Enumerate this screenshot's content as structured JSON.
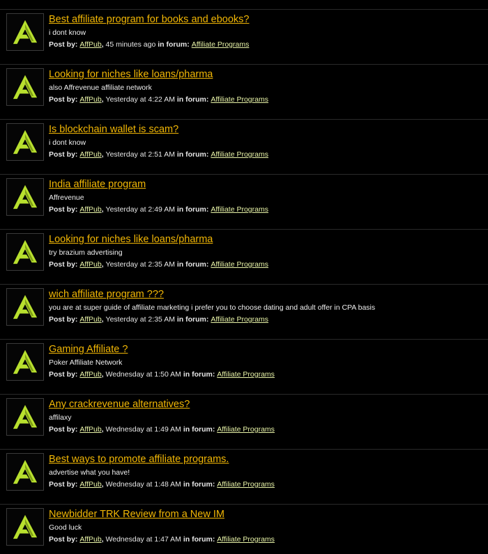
{
  "colors": {
    "background": "#000000",
    "title": "#f2b705",
    "link": "#e9f4a8",
    "logo_accent": "#b8e02e"
  },
  "avatar_icon": "affpub-logo-icon",
  "labels": {
    "post_by": "Post by:",
    "in_forum": "in forum:"
  },
  "posts": [
    {
      "title": "Best affiliate program for books and ebooks?",
      "snippet": "i dont know",
      "author": "AffPub",
      "time": "45 minutes ago",
      "forum": "Affiliate Programs"
    },
    {
      "title": "Looking for niches like loans/pharma",
      "snippet": "also Affrevenue affiliate network",
      "author": "AffPub",
      "time": "Yesterday at 4:22 AM",
      "forum": "Affiliate Programs"
    },
    {
      "title": "Is blockchain wallet is scam?",
      "snippet": "i dont know",
      "author": "AffPub",
      "time": "Yesterday at 2:51 AM",
      "forum": "Affiliate Programs"
    },
    {
      "title": "India affiliate program",
      "snippet": "Affrevenue",
      "author": "AffPub",
      "time": "Yesterday at 2:49 AM",
      "forum": "Affiliate Programs"
    },
    {
      "title": "Looking for niches like loans/pharma",
      "snippet": "try brazium advertising",
      "author": "AffPub",
      "time": "Yesterday at 2:35 AM",
      "forum": "Affiliate Programs"
    },
    {
      "title": "wich affiliate program ???",
      "snippet": "you are at super guide of affiliate marketing i prefer you to choose dating and adult offer in CPA basis",
      "author": "AffPub",
      "time": "Yesterday at 2:35 AM",
      "forum": "Affiliate Programs"
    },
    {
      "title": "Gaming Affiliate ?",
      "snippet": "Poker Affiliate Network",
      "author": "AffPub",
      "time": "Wednesday at 1:50 AM",
      "forum": "Affiliate Programs"
    },
    {
      "title": "Any crackrevenue alternatives?",
      "snippet": "affilaxy",
      "author": "AffPub",
      "time": "Wednesday at 1:49 AM",
      "forum": "Affiliate Programs"
    },
    {
      "title": "Best ways to promote affiliate programs.",
      "snippet": "advertise what you have!",
      "author": "AffPub",
      "time": "Wednesday at 1:48 AM",
      "forum": "Affiliate Programs"
    },
    {
      "title": "Newbidder TRK Review from a New IM",
      "snippet": "Good luck",
      "author": "AffPub",
      "time": "Wednesday at 1:47 AM",
      "forum": "Affiliate Programs"
    }
  ]
}
